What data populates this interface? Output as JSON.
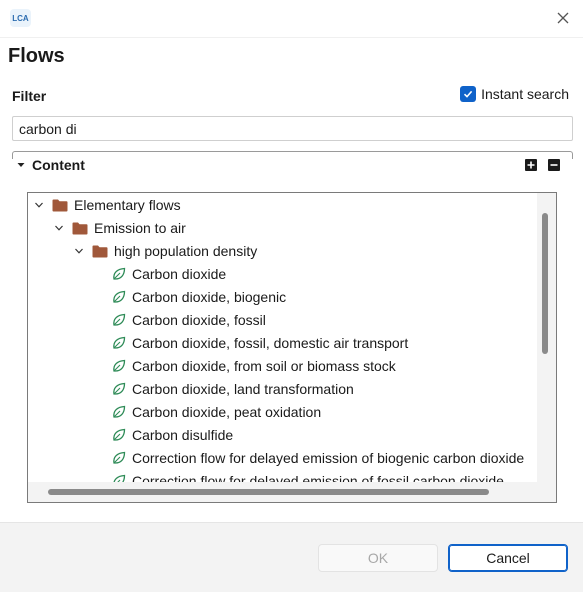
{
  "window": {
    "title": "Flows",
    "app_icon_text": "LCA"
  },
  "filter": {
    "label": "Filter",
    "query": "carbon di",
    "instant_search": {
      "label": "Instant search",
      "checked": true
    }
  },
  "content": {
    "label": "Content",
    "tree": [
      {
        "label": "Elementary flows",
        "icon": "folder-icon",
        "expanded": true
      },
      {
        "label": "Emission to air",
        "icon": "folder-icon",
        "expanded": true
      },
      {
        "label": "high population density",
        "icon": "folder-icon",
        "expanded": true
      },
      {
        "label": "Carbon dioxide",
        "icon": "leaf-icon"
      },
      {
        "label": "Carbon dioxide, biogenic",
        "icon": "leaf-icon"
      },
      {
        "label": "Carbon dioxide, fossil",
        "icon": "leaf-icon"
      },
      {
        "label": "Carbon dioxide, fossil, domestic air transport",
        "icon": "leaf-icon"
      },
      {
        "label": "Carbon dioxide, from soil or biomass stock",
        "icon": "leaf-icon"
      },
      {
        "label": "Carbon dioxide, land transformation",
        "icon": "leaf-icon"
      },
      {
        "label": "Carbon dioxide, peat oxidation",
        "icon": "leaf-icon"
      },
      {
        "label": "Carbon disulfide",
        "icon": "leaf-icon"
      },
      {
        "label": "Correction flow for delayed emission of biogenic carbon dioxide",
        "icon": "leaf-icon"
      },
      {
        "label": "Correction flow for delayed emission of fossil carbon dioxide",
        "icon": "leaf-icon"
      }
    ]
  },
  "buttons": {
    "ok": "OK",
    "cancel": "Cancel"
  },
  "colors": {
    "accent": "#0f62c9",
    "folder": "#a0583a",
    "leaf": "#2e8b57"
  }
}
